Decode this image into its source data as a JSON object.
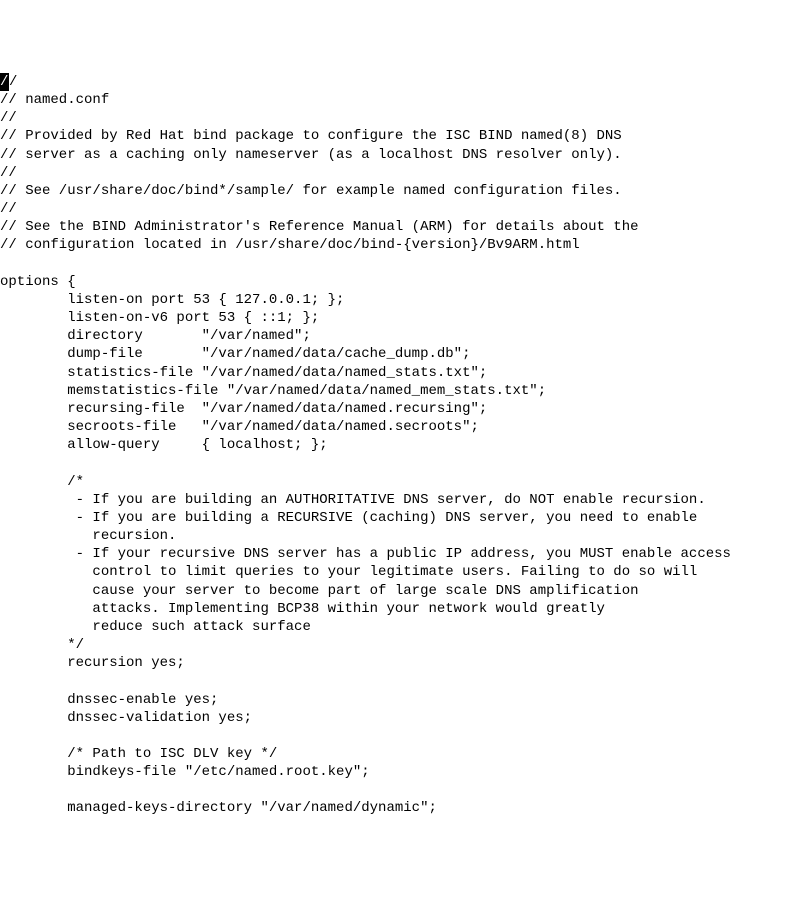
{
  "editor": {
    "cursor_char": "/",
    "first_line_remainder": "/",
    "lines": [
      "// named.conf",
      "//",
      "// Provided by Red Hat bind package to configure the ISC BIND named(8) DNS",
      "// server as a caching only nameserver (as a localhost DNS resolver only).",
      "//",
      "// See /usr/share/doc/bind*/sample/ for example named configuration files.",
      "//",
      "// See the BIND Administrator's Reference Manual (ARM) for details about the",
      "// configuration located in /usr/share/doc/bind-{version}/Bv9ARM.html",
      "",
      "options {",
      "        listen-on port 53 { 127.0.0.1; };",
      "        listen-on-v6 port 53 { ::1; };",
      "        directory       \"/var/named\";",
      "        dump-file       \"/var/named/data/cache_dump.db\";",
      "        statistics-file \"/var/named/data/named_stats.txt\";",
      "        memstatistics-file \"/var/named/data/named_mem_stats.txt\";",
      "        recursing-file  \"/var/named/data/named.recursing\";",
      "        secroots-file   \"/var/named/data/named.secroots\";",
      "        allow-query     { localhost; };",
      "",
      "        /*",
      "         - If you are building an AUTHORITATIVE DNS server, do NOT enable recursion.",
      "         - If you are building a RECURSIVE (caching) DNS server, you need to enable",
      "           recursion.",
      "         - If your recursive DNS server has a public IP address, you MUST enable access",
      "           control to limit queries to your legitimate users. Failing to do so will",
      "           cause your server to become part of large scale DNS amplification",
      "           attacks. Implementing BCP38 within your network would greatly",
      "           reduce such attack surface",
      "        */",
      "        recursion yes;",
      "",
      "        dnssec-enable yes;",
      "        dnssec-validation yes;",
      "",
      "        /* Path to ISC DLV key */",
      "        bindkeys-file \"/etc/named.root.key\";",
      "",
      "        managed-keys-directory \"/var/named/dynamic\";"
    ]
  }
}
